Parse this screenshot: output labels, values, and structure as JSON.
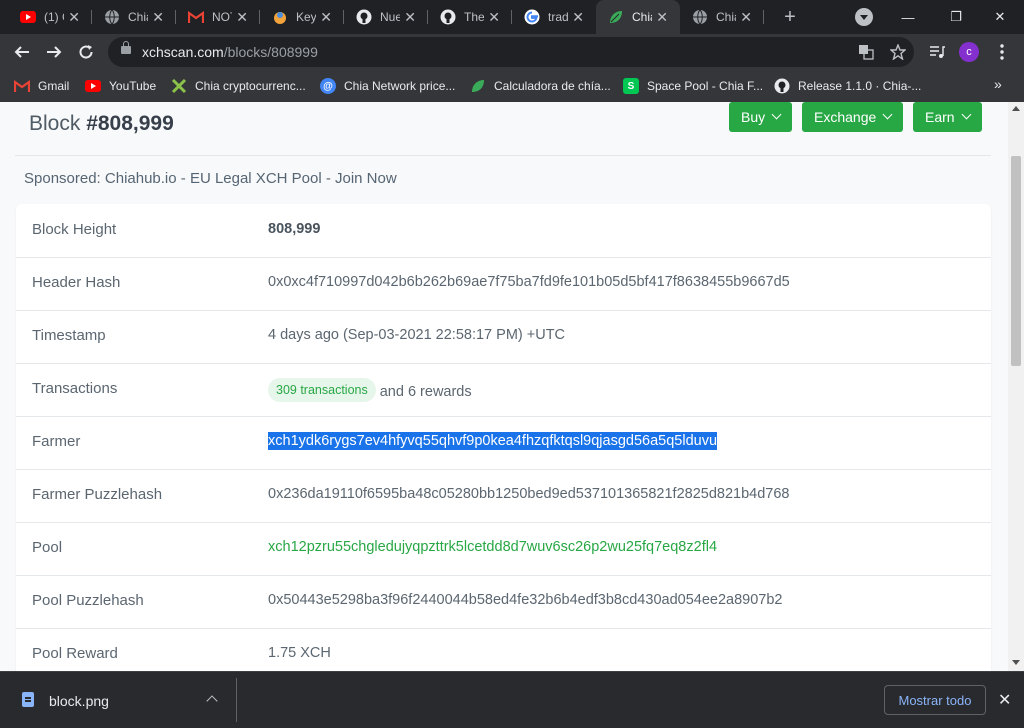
{
  "browser": {
    "tabs": [
      {
        "title": "(1) C",
        "icon": "youtube-icon"
      },
      {
        "title": "Chia",
        "icon": "globe-icon"
      },
      {
        "title": "NOT",
        "icon": "gmail-icon"
      },
      {
        "title": "Key",
        "icon": "keybase-icon"
      },
      {
        "title": "Nue",
        "icon": "github-icon"
      },
      {
        "title": "The",
        "icon": "github-icon"
      },
      {
        "title": "trad",
        "icon": "google-icon"
      },
      {
        "title": "Chia",
        "icon": "chia-leaf-icon",
        "active": true
      },
      {
        "title": "Chia",
        "icon": "globe-icon"
      }
    ],
    "tab_close": "✕",
    "new_tab": "+",
    "window_controls": {
      "minimize": "—",
      "maximize": "❐",
      "close": "✕"
    },
    "url_host": "xchscan.com",
    "url_path": "/blocks/808999",
    "avatar_letter": "c",
    "bookmarks": [
      {
        "label": "Gmail",
        "icon": "gmail-icon"
      },
      {
        "label": "YouTube",
        "icon": "youtube-icon"
      },
      {
        "label": "Chia cryptocurrenc...",
        "icon": "chia-leaf-icon"
      },
      {
        "label": "Chia Network price...",
        "icon": "at-sign-icon"
      },
      {
        "label": "Calculadora de chía...",
        "icon": "chia-leaf-icon"
      },
      {
        "label": "Space Pool - Chia F...",
        "icon": "spacepool-icon"
      },
      {
        "label": "Release 1.1.0 · Chia-...",
        "icon": "github-icon"
      }
    ],
    "bookmarks_more": "»"
  },
  "page": {
    "title_prefix": "Block",
    "title_number": "#808,999",
    "buttons": {
      "buy": "Buy",
      "exchange": "Exchange",
      "earn": "Earn"
    },
    "sponsored": "Sponsored:  Chiahub.io - EU Legal XCH Pool - Join Now",
    "details": [
      {
        "key": "Block Height",
        "value": "808,999"
      },
      {
        "key": "Header Hash",
        "value": "0x0xc4f710997d042b6b262b69ae7f75ba7fd9fe101b05d5bf417f8638455b9667d5"
      },
      {
        "key": "Timestamp",
        "value": "4 days ago (Sep-03-2021 22:58:17 PM) +UTC"
      },
      {
        "key": "Transactions",
        "badge": "309 transactions",
        "value": "and 6 rewards"
      },
      {
        "key": "Farmer",
        "value": "xch1ydk6rygs7ev4hfyvq55qhvf9p0kea4fhzqfktqsl9qjasgd56a5q5lduvu"
      },
      {
        "key": "Farmer Puzzlehash",
        "value": "0x236da19110f6595ba48c05280bb1250bed9ed537101365821f2825d821b4d768"
      },
      {
        "key": "Pool",
        "value": "xch12pzru55chgledujyqpzttrk5lcetdd8d7wuv6sc26p2wu25fq7eq8z2fl4"
      },
      {
        "key": "Pool Puzzlehash",
        "value": "0x50443e5298ba3f96f2440044b58ed4fe32b6b4edf3b8cd430ad054ee2a8907b2"
      },
      {
        "key": "Pool Reward",
        "value": "1.75 XCH"
      }
    ]
  },
  "downloads": {
    "file_name": "block.png",
    "show_all": "Mostrar todo",
    "close": "✕"
  }
}
